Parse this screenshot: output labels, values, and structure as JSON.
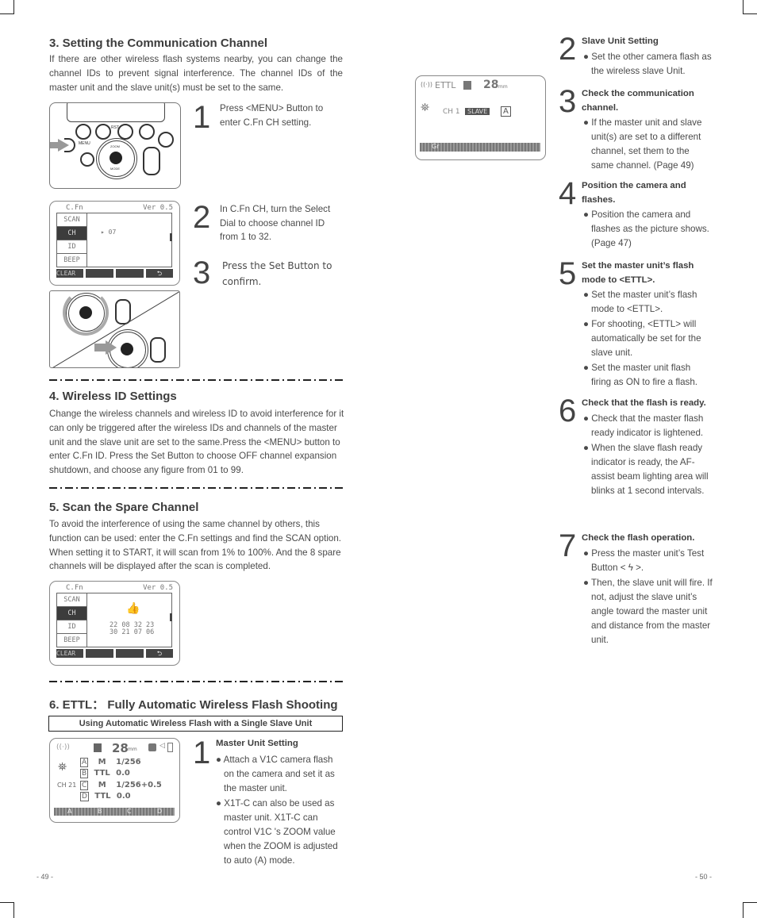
{
  "left_page": {
    "section3": {
      "title": "3. Setting the Communication Channel",
      "body": "If there are other wireless flash systems nearby, you can change the channel IDs to prevent signal interference. The channel IDs of the master unit and the slave unit(s) must be set to the same.",
      "steps": [
        {
          "num": "1",
          "text": "Press <MENU> Button to enter C.Fn CH setting."
        },
        {
          "num": "2",
          "text": "In C.Fn CH, turn the Select Dial to choose channel ID from 1 to 32."
        },
        {
          "num": "3",
          "text": "Press the Set Button to confirm."
        }
      ],
      "device_labels": {
        "menu": "MENU",
        "rst": "RST",
        "zoom": "ZOOM",
        "mode": "MODE"
      },
      "lcd": {
        "header_left": "C.Fn",
        "header_right": "Ver 0.5",
        "menu": [
          "SCAN",
          "CH",
          "ID",
          "BEEP"
        ],
        "selected": "CH",
        "value": "07",
        "footer_left": "CLEAR",
        "footer_right_icon": "return-icon"
      }
    },
    "section4": {
      "title": "4. Wireless ID Settings",
      "body": "Change the wireless channels and wireless ID to avoid interference for it can only be triggered after the wireless IDs and channels of the master unit and the slave unit are set to the same.Press the <MENU> button to enter C.Fn ID. Press the Set Button to choose OFF channel expansion shutdown, and choose any figure from 01 to 99."
    },
    "section5": {
      "title": "5. Scan the Spare Channel",
      "body": "To avoid the interference of using the same channel by others, this function can be used: enter the C.Fn settings and find the SCAN option. When setting it to START, it will scan from 1% to 100%. And the 8 spare channels will be displayed after the scan is completed.",
      "lcd": {
        "header_left": "C.Fn",
        "header_right": "Ver 0.5",
        "menu": [
          "SCAN",
          "CH",
          "ID",
          "BEEP"
        ],
        "selected": "CH",
        "channels_row1": "22 08 32 23",
        "channels_row2": "30 21 07 06",
        "footer_left": "CLEAR",
        "icon": "thumbs-up-icon"
      }
    },
    "section6": {
      "title": "6. ETTL： Fully Automatic Wireless Flash Shooting",
      "subtitle": "Using Automatic Wireless Flash with a Single Slave Unit",
      "master_lcd": {
        "zoom": "28",
        "zoom_unit": "mm",
        "channel": "CH 21",
        "groups": [
          {
            "group": "A",
            "mode": "M",
            "value": "1/256"
          },
          {
            "group": "B",
            "mode": "TTL",
            "value": "0.0"
          },
          {
            "group": "C",
            "mode": "M",
            "value": "1/256+0.5"
          },
          {
            "group": "D",
            "mode": "TTL",
            "value": "0.0"
          }
        ],
        "softkeys": [
          "A",
          "B",
          "C",
          "D"
        ]
      },
      "step1": {
        "num": "1",
        "title": "Master Unit Setting",
        "bullets": [
          "● Attach a  V1C camera flash on the camera and set it as the master unit.",
          "● X1T-C can also be used as master unit. X1T-C can control V1C 's ZOOM value when the ZOOM is adjusted to auto (A) mode."
        ]
      }
    },
    "page_number": "- 49 -"
  },
  "right_page": {
    "slave_lcd": {
      "mode": "ETTL",
      "zoom": "28",
      "zoom_unit": "mm",
      "channel": "CH 1",
      "role": "SLAVE",
      "group": "A",
      "softkeys": [
        "Gr",
        "",
        "",
        ""
      ]
    },
    "steps": [
      {
        "num": "2",
        "title": "Slave Unit Setting",
        "bullets": [
          "● Set the other camera flash as the wireless slave Unit."
        ]
      },
      {
        "num": "3",
        "title": "Check the communication channel.",
        "bullets": [
          "● If the master unit and slave unit(s) are set to a different channel, set them to the same channel. (Page 49)"
        ]
      },
      {
        "num": "4",
        "title": "Position the camera and flashes.",
        "bullets": [
          "● Position the camera and flashes as the picture shows. (Page 47)"
        ]
      },
      {
        "num": "5",
        "title": "Set the master unit’s flash mode to <ETTL>.",
        "bullets": [
          "● Set the master unit’s flash mode to <ETTL>.",
          "● For shooting, <ETTL> will automatically be set for the slave unit.",
          "● Set the master unit flash firing as ON to fire a flash."
        ]
      },
      {
        "num": "6",
        "title": "Check that the flash is ready.",
        "bullets": [
          "● Check that the master flash ready indicator is lightened.",
          "● When the slave flash ready indicator is ready, the AF-assist beam lighting area will blinks at 1 second intervals."
        ]
      },
      {
        "num": "7",
        "title": "Check the flash operation.",
        "bullets": [
          "● Press the master unit’s Test Button < ϟ >.",
          "● Then, the slave unit will fire. If not, adjust the slave unit’s angle toward the master unit and distance from the master unit."
        ]
      }
    ],
    "page_number": "- 50 -"
  }
}
